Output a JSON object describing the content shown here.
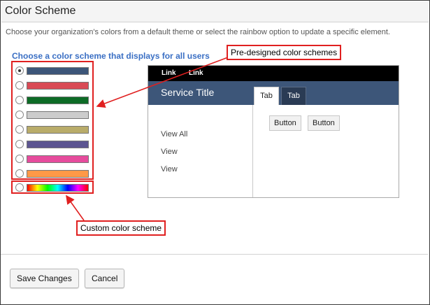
{
  "window": {
    "title": "Color Scheme"
  },
  "description": "Choose your organization's colors from a default theme or select the rainbow option to update a specific element.",
  "schemes": {
    "heading": "Choose a color scheme that displays for all users",
    "selected_index": 0,
    "swatches": [
      {
        "color": "#3d5679"
      },
      {
        "color": "#d94a55"
      },
      {
        "color": "#0d6b26"
      },
      {
        "color": "#cccccc"
      },
      {
        "color": "#b9ac6a"
      },
      {
        "color": "#5c5591"
      },
      {
        "color": "#e64c9d"
      },
      {
        "color": "#ff9947"
      }
    ],
    "custom": {
      "style": "rainbow"
    }
  },
  "preview": {
    "links": [
      "Link",
      "Link"
    ],
    "service_title": "Service Title",
    "tabs": [
      "Tab",
      "Tab"
    ],
    "buttons": [
      "Button",
      "Button"
    ],
    "nav": [
      "View All",
      "View",
      "View"
    ]
  },
  "callouts": {
    "predesigned": "Pre-designed color schemes",
    "custom": "Custom color scheme"
  },
  "footer": {
    "save_label": "Save Changes",
    "cancel_label": "Cancel"
  }
}
